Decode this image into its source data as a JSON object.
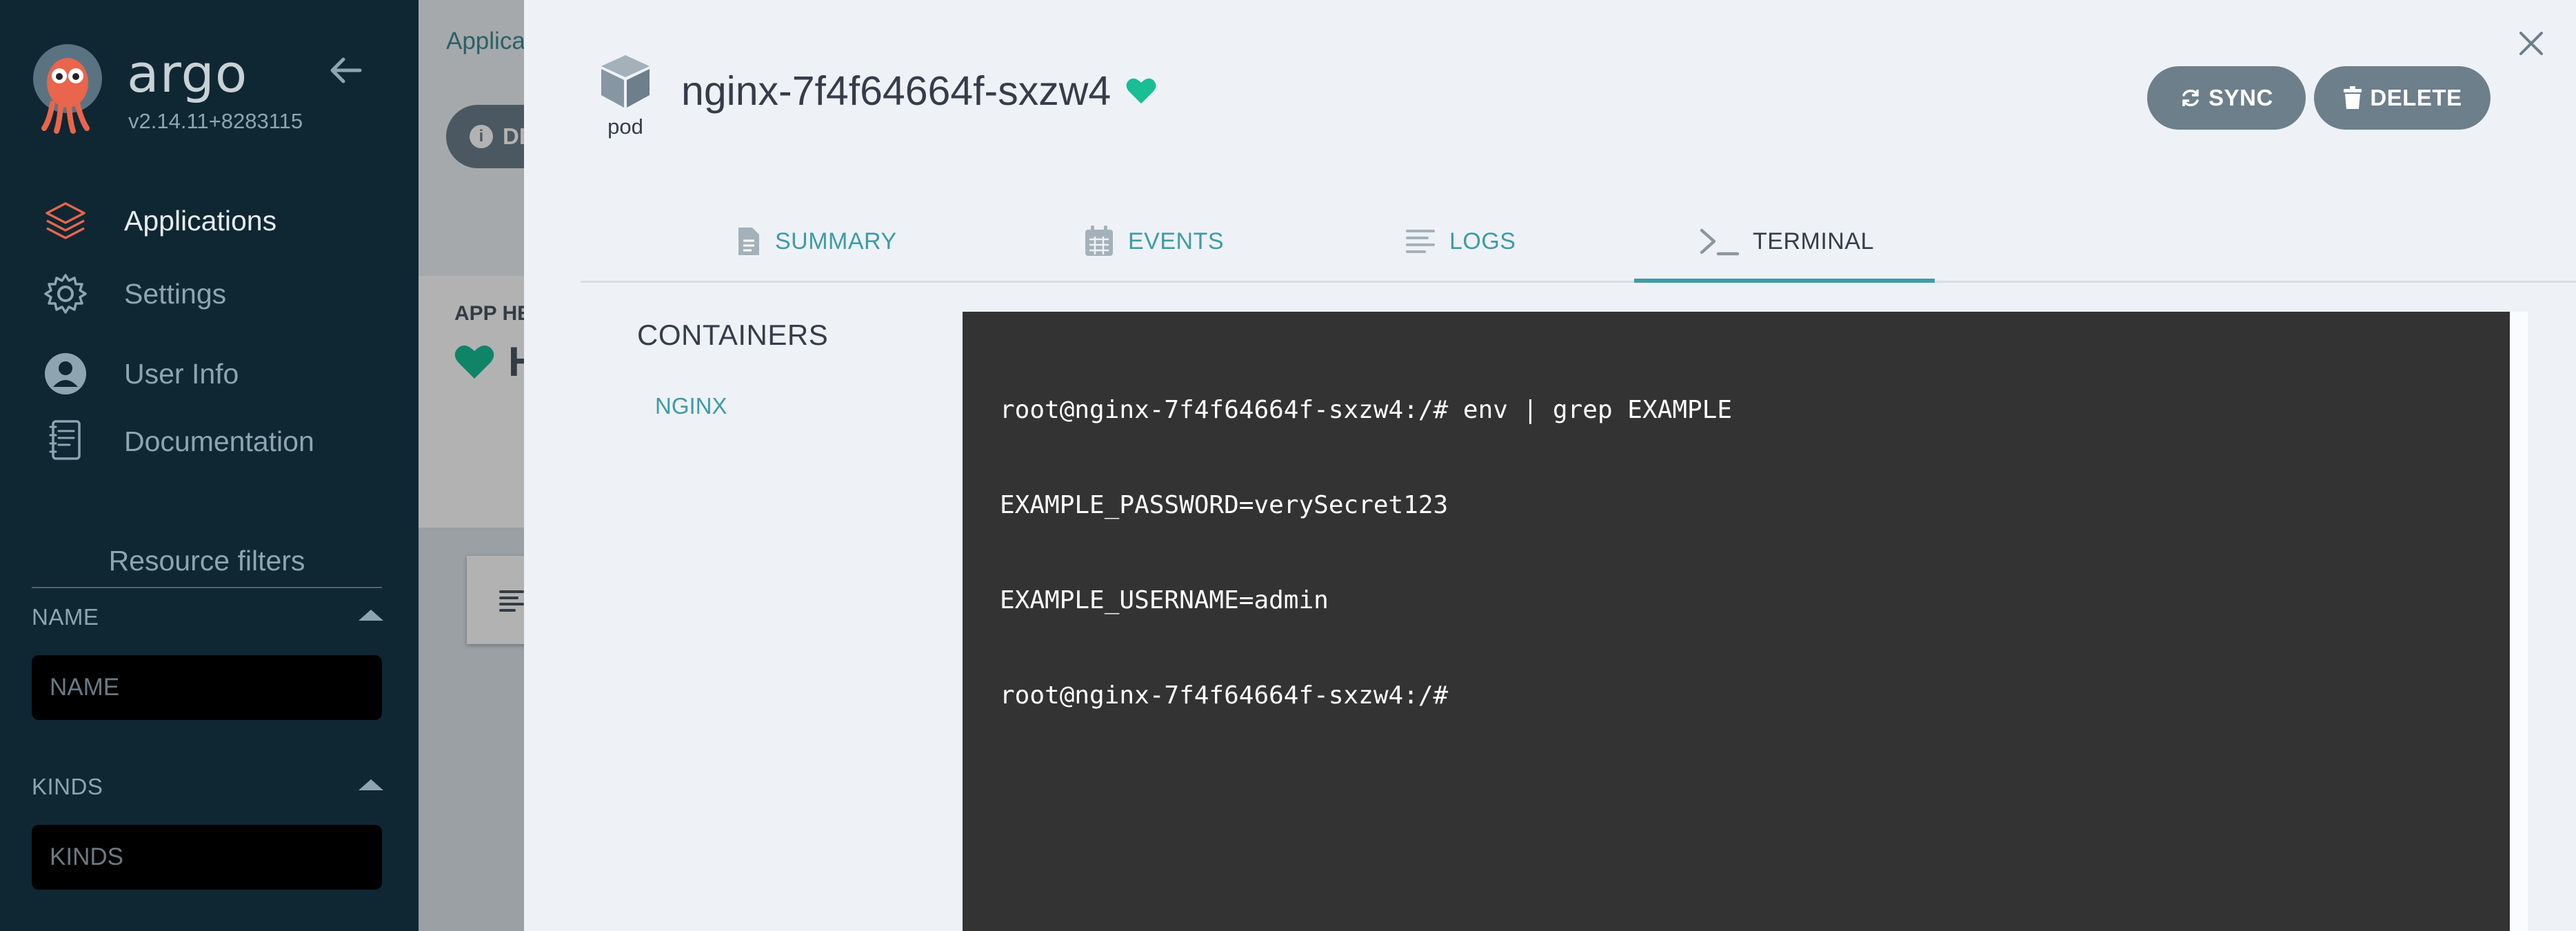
{
  "sidebar": {
    "brand": "argo",
    "version": "v2.14.11+8283115",
    "nav": [
      {
        "label": "Applications",
        "icon": "layers-icon",
        "active": true
      },
      {
        "label": "Settings",
        "icon": "gear-icon",
        "active": false
      },
      {
        "label": "User Info",
        "icon": "user-circle-icon",
        "active": false
      },
      {
        "label": "Documentation",
        "icon": "book-icon",
        "active": false
      }
    ],
    "filters_title": "Resource filters",
    "filters": [
      {
        "label": "NAME",
        "placeholder": "NAME"
      },
      {
        "label": "KINDS",
        "placeholder": "KINDS"
      }
    ]
  },
  "background": {
    "breadcrumb": "Applica",
    "details_button": "DE",
    "health_label": "APP HE",
    "health_value": "H"
  },
  "panel": {
    "kind": "pod",
    "title": "nginx-7f4f64664f-sxzw4",
    "sync_label": "SYNC",
    "delete_label": "DELETE",
    "tabs": [
      {
        "label": "SUMMARY",
        "icon": "file-icon"
      },
      {
        "label": "EVENTS",
        "icon": "calendar-icon"
      },
      {
        "label": "LOGS",
        "icon": "lines-icon"
      },
      {
        "label": "TERMINAL",
        "icon": "terminal-icon"
      }
    ],
    "active_tab": "TERMINAL",
    "containers_title": "CONTAINERS",
    "containers": [
      "NGINX"
    ],
    "terminal_lines": [
      "root@nginx-7f4f64664f-sxzw4:/# env | grep EXAMPLE",
      "EXAMPLE_PASSWORD=verySecret123",
      "EXAMPLE_USERNAME=admin",
      "root@nginx-7f4f64664f-sxzw4:/#"
    ]
  },
  "colors": {
    "sidebar_bg": "#0f2733",
    "accent": "#3e9ba7",
    "healthy": "#18be94",
    "button_bg": "#6d7f8b",
    "terminal_bg": "#333333"
  }
}
